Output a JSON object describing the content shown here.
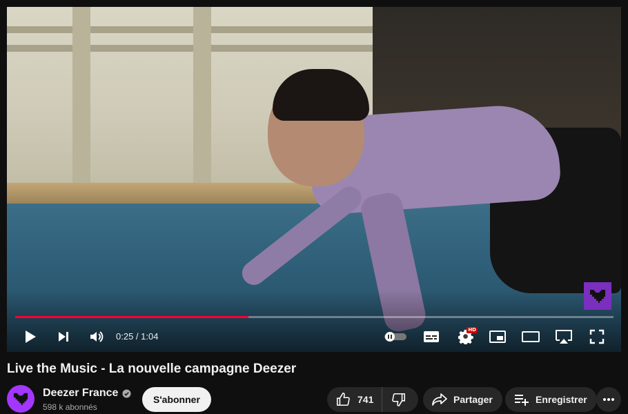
{
  "player": {
    "time_current": "0:25",
    "time_separator": " / ",
    "time_total": "1:04",
    "progress_fraction": 0.39,
    "hd_badge": "HD",
    "accent_color": "#ff0033"
  },
  "video": {
    "title": "Live the Music - La nouvelle campagne Deezer"
  },
  "channel": {
    "name": "Deezer France",
    "subscribers": "598 k abonnés",
    "verified_icon": "verified-check-icon",
    "brand_color": "#a238ff"
  },
  "actions": {
    "subscribe_label": "S'abonner",
    "like_count": "741",
    "share_label": "Partager",
    "save_label": "Enregistrer"
  },
  "icons": {
    "play": "play-icon",
    "next": "next-icon",
    "volume": "volume-icon",
    "autoplay": "autoplay-toggle",
    "subtitles": "subtitles-icon",
    "settings": "gear-icon",
    "miniplayer": "miniplayer-icon",
    "theater": "theater-icon",
    "cast": "cast-icon",
    "fullscreen": "fullscreen-icon"
  }
}
